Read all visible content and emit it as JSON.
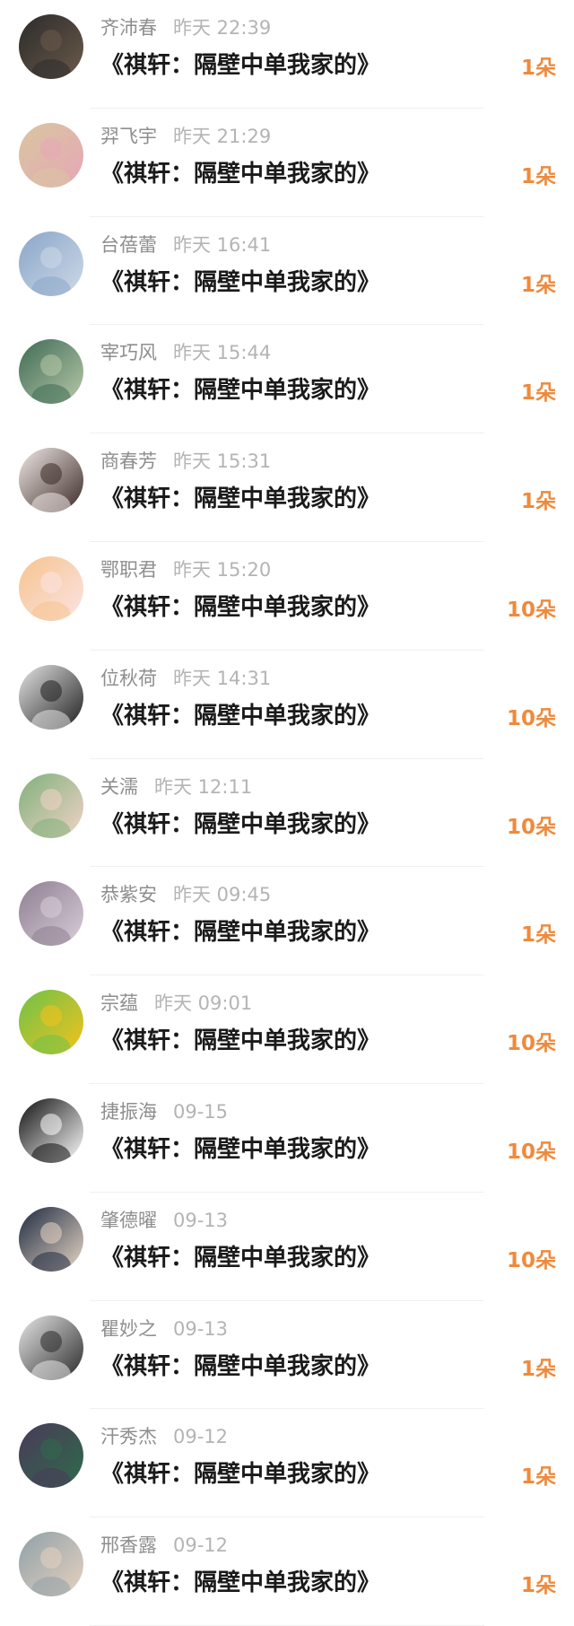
{
  "gifts": [
    {
      "name": "齐沛春",
      "time": "昨天 22:39",
      "title": "《祺轩：隔壁中单我家的》",
      "count": "1朵",
      "avatar_icon": "man-portrait-dark-icon",
      "avatar_colors": [
        "#2b2b2b",
        "#6b5a4a"
      ]
    },
    {
      "name": "羿飞宇",
      "time": "昨天 21:29",
      "title": "《祺轩：隔壁中单我家的》",
      "count": "1朵",
      "avatar_icon": "two-people-photo-icon",
      "avatar_colors": [
        "#d9c6a0",
        "#e6a7b6"
      ]
    },
    {
      "name": "台蓓蕾",
      "time": "昨天 16:41",
      "title": "《祺轩：隔壁中单我家的》",
      "count": "1朵",
      "avatar_icon": "sky-clouds-photo-icon",
      "avatar_colors": [
        "#8aa6c8",
        "#cdd9e8"
      ]
    },
    {
      "name": "宰巧风",
      "time": "昨天 15:44",
      "title": "《祺轩：隔壁中单我家的》",
      "count": "1朵",
      "avatar_icon": "anime-scene-icon",
      "avatar_colors": [
        "#3e6b55",
        "#b8c8a8"
      ]
    },
    {
      "name": "商春芳",
      "time": "昨天 15:31",
      "title": "《祺轩：隔壁中单我家的》",
      "count": "1朵",
      "avatar_icon": "woman-portrait-icon",
      "avatar_colors": [
        "#f0e8e6",
        "#3a2a26"
      ]
    },
    {
      "name": "鄂职君",
      "time": "昨天 15:20",
      "title": "《祺轩：隔壁中单我家的》",
      "count": "10朵",
      "avatar_icon": "anime-girl-icon",
      "avatar_colors": [
        "#f6c48e",
        "#fbe3e3"
      ]
    },
    {
      "name": "位秋荷",
      "time": "昨天 14:31",
      "title": "《祺轩：隔壁中单我家的》",
      "count": "10朵",
      "avatar_icon": "man-portrait-bw-icon",
      "avatar_colors": [
        "#e4e4e4",
        "#1f1f1f"
      ]
    },
    {
      "name": "关濡",
      "time": "昨天 12:11",
      "title": "《祺轩：隔壁中单我家的》",
      "count": "10朵",
      "avatar_icon": "woman-flowers-icon",
      "avatar_colors": [
        "#7fb07a",
        "#f2d3c8"
      ]
    },
    {
      "name": "恭紫安",
      "time": "昨天 09:45",
      "title": "《祺轩：隔壁中单我家的》",
      "count": "1朵",
      "avatar_icon": "anime-portrait-icon",
      "avatar_colors": [
        "#8f7f92",
        "#d8cdd8"
      ]
    },
    {
      "name": "宗蕴",
      "time": "昨天 09:01",
      "title": "《祺轩：隔壁中单我家的》",
      "count": "10朵",
      "avatar_icon": "cartoon-cat-icon",
      "avatar_colors": [
        "#6cc24a",
        "#f5c21b"
      ]
    },
    {
      "name": "捷振海",
      "time": "09-15",
      "title": "《祺轩：隔壁中单我家的》",
      "count": "10朵",
      "avatar_icon": "panda-icon",
      "avatar_colors": [
        "#111111",
        "#ffffff"
      ]
    },
    {
      "name": "肇德曜",
      "time": "09-13",
      "title": "《祺轩：隔壁中单我家的》",
      "count": "10朵",
      "avatar_icon": "man-suit-icon",
      "avatar_colors": [
        "#1d2a40",
        "#e8d6c6"
      ]
    },
    {
      "name": "瞿妙之",
      "time": "09-13",
      "title": "《祺轩：隔壁中单我家的》",
      "count": "1朵",
      "avatar_icon": "man-dark-outfit-icon",
      "avatar_colors": [
        "#e7e7e7",
        "#2a2a2a"
      ]
    },
    {
      "name": "汗秀杰",
      "time": "09-12",
      "title": "《祺轩：隔壁中单我家的》",
      "count": "1朵",
      "avatar_icon": "green-car-icon",
      "avatar_colors": [
        "#4a3a5a",
        "#2f6a4a"
      ]
    },
    {
      "name": "邢香露",
      "time": "09-12",
      "title": "《祺轩：隔壁中单我家的》",
      "count": "1朵",
      "avatar_icon": "child-selfie-icon",
      "avatar_colors": [
        "#8fa0a8",
        "#e6d2c0"
      ]
    }
  ],
  "colors": {
    "name": "#8e8e8e",
    "time": "#b4b4b4",
    "title": "#1a1a1a",
    "count": "#ef8a3c",
    "divider": "#f0f0f0"
  }
}
